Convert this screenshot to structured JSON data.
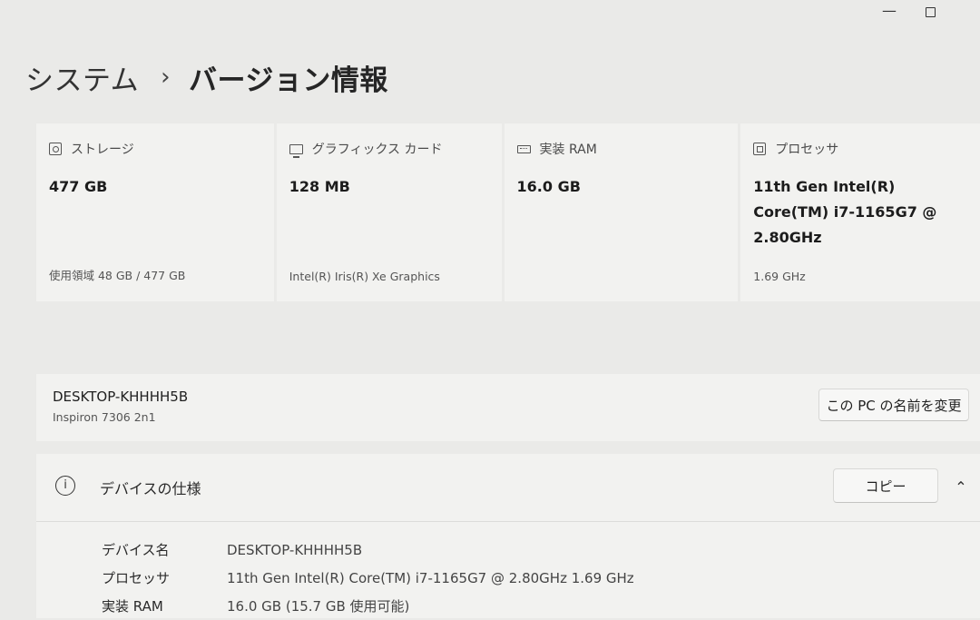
{
  "window": {
    "minimize_glyph": "—"
  },
  "breadcrumb": {
    "parent": "システム",
    "separator": "›",
    "current": "バージョン情報"
  },
  "specs": [
    {
      "icon": "storage-icon",
      "title": "ストレージ",
      "value": "477 GB",
      "sub": "使用領域 48 GB / 477 GB"
    },
    {
      "icon": "graphics-card-icon",
      "title": "グラフィックス カード",
      "value": "128 MB",
      "sub": "Intel(R) Iris(R) Xe Graphics"
    },
    {
      "icon": "ram-icon",
      "title": "実装 RAM",
      "value": "16.0 GB",
      "sub": ""
    },
    {
      "icon": "processor-icon",
      "title": "プロセッサ",
      "value_lines": [
        "11th Gen Intel(R)",
        "Core(TM) i7-1165G7 @",
        "2.80GHz"
      ],
      "sub": "1.69 GHz"
    }
  ],
  "device": {
    "name": "DESKTOP-KHHHH5B",
    "model": "Inspiron 7306 2n1",
    "rename_label": "この PC の名前を変更"
  },
  "device_specs": {
    "icon_glyph": "i",
    "title": "デバイスの仕様",
    "copy_label": "コピー",
    "collapse_glyph": "⌃",
    "rows": [
      {
        "label": "デバイス名",
        "value": "DESKTOP-KHHHH5B"
      },
      {
        "label": "プロセッサ",
        "value": "11th Gen Intel(R) Core(TM) i7-1165G7 @ 2.80GHz   1.69 GHz"
      },
      {
        "label": "実装 RAM",
        "value": "16.0 GB (15.7 GB 使用可能)"
      }
    ]
  }
}
